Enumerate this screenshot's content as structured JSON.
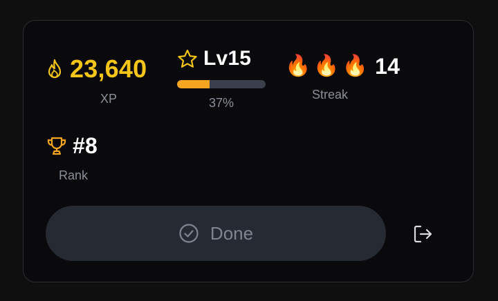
{
  "stats": {
    "xp": {
      "value": "23,640",
      "label": "XP",
      "icon": "flame-outline-icon"
    },
    "level": {
      "value": "Lv15",
      "progress_label": "37%",
      "progress": 0.37,
      "icon": "star-outline-icon"
    },
    "streak": {
      "flames": [
        "🔥",
        "🔥",
        "🔥"
      ],
      "value": "14",
      "label": "Streak"
    },
    "rank": {
      "value": "#8",
      "label": "Rank",
      "icon": "trophy-icon"
    }
  },
  "actions": {
    "done_label": "Done",
    "done_icon": "check-circle-icon",
    "logout_icon": "logout-icon"
  },
  "colors": {
    "xp": "#f5c518",
    "progress_fill": "#f5a51f",
    "progress_track": "#3a3f4b",
    "button_bg": "#262a33",
    "text_muted": "#8a8f98"
  }
}
